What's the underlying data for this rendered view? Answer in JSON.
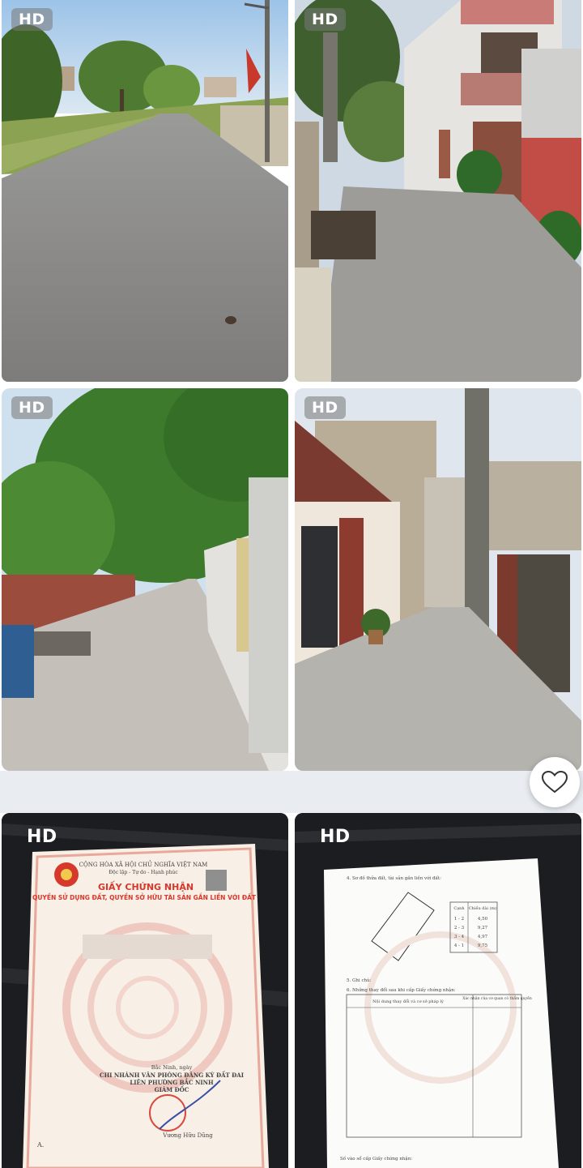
{
  "badges": {
    "hd": "HD"
  },
  "certificate": {
    "header_line1": "CỘNG HÒA XÃ HỘI CHỦ NGHĨA VIỆT NAM",
    "header_line2": "Độc lập - Tự do - Hạnh phúc",
    "title": "GIẤY CHỨNG NHẬN",
    "subtitle": "QUYỀN SỬ DỤNG ĐẤT, QUYỀN SỞ HỮU TÀI SẢN GẮN LIỀN VỚI ĐẤT",
    "office_line1": "CHI NHÁNH VĂN PHÒNG ĐĂNG KÝ ĐẤT ĐAI",
    "office_line2": "LIÊN PHƯỜNG BẮC NINH",
    "role": "GIÁM ĐỐC",
    "signer": "Vương Hữu Dũng",
    "place": "Bắc Ninh, ngày",
    "serial_prefix": "A."
  },
  "plot": {
    "section4": "4. Sơ đồ thửa đất, tài sản gắn liền với đất:",
    "section5": "5. Ghi chú:",
    "section6": "6. Những thay đổi sau khi cấp Giấy chứng nhận:",
    "col_change": "Nội dung thay đổi và cơ sở pháp lý",
    "col_confirm": "Xác nhận của cơ quan có thẩm quyền",
    "edge_header": [
      "Cạnh",
      "Chiều dài (m)"
    ],
    "edges": [
      [
        "1 - 2",
        "4,50"
      ],
      [
        "2 - 3",
        "9,27"
      ],
      [
        "3 - 4",
        "4,97"
      ],
      [
        "4 - 1",
        "9,75"
      ]
    ],
    "footer": "Số vào sổ cấp Giấy chứng nhận:"
  },
  "actions": {
    "favorite_icon": "heart-icon"
  },
  "colors": {
    "accent_red": "#d8382b",
    "dark_bg": "#1c1d20",
    "band": "#e9edf1"
  }
}
